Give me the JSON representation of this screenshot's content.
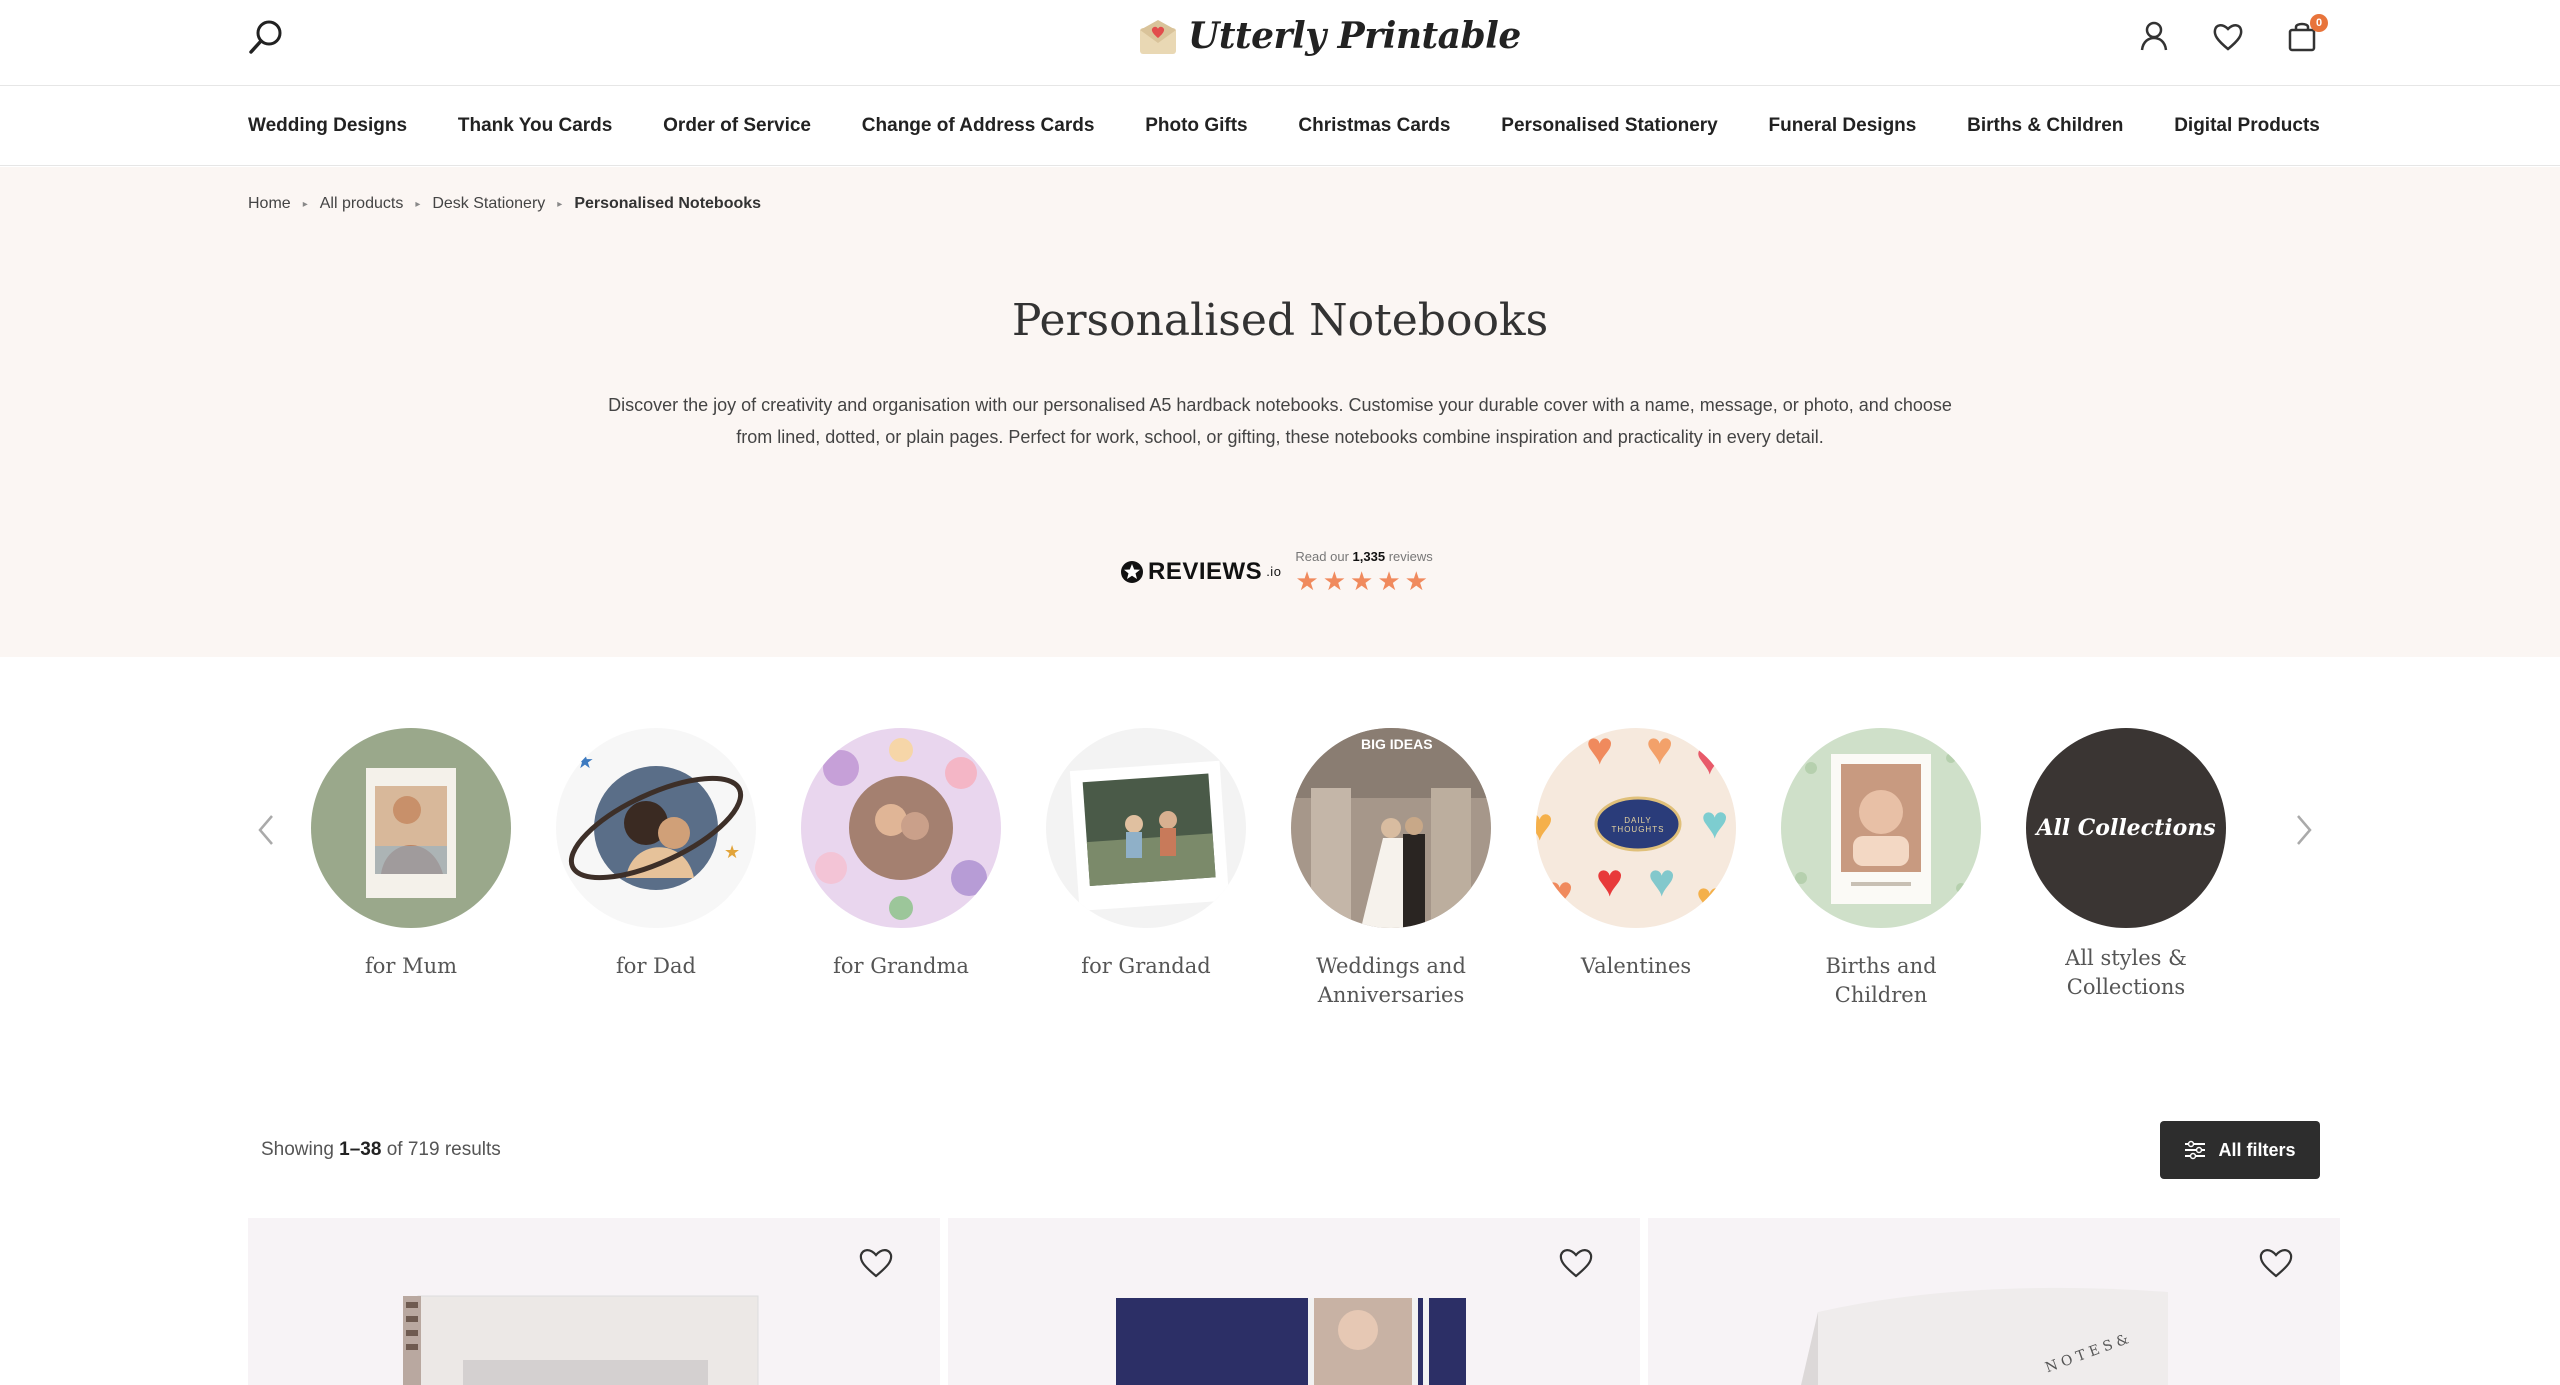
{
  "header": {
    "brand": "Utterly Printable",
    "cart_count": "0",
    "icons": [
      "search-icon",
      "account-icon",
      "wishlist-heart-icon",
      "cart-bag-icon"
    ]
  },
  "nav": {
    "items": [
      "Wedding Designs",
      "Thank You Cards",
      "Order of Service",
      "Change of Address Cards",
      "Photo Gifts",
      "Christmas Cards",
      "Personalised Stationery",
      "Funeral Designs",
      "Births & Children",
      "Digital Products"
    ]
  },
  "breadcrumb": [
    "Home",
    "All products",
    "Desk Stationery",
    "Personalised Notebooks"
  ],
  "hero": {
    "title": "Personalised Notebooks",
    "description": "Discover the joy of creativity and organisation with our personalised A5 hardback notebooks. Customise your durable cover with a name, message, or photo, and choose from lined, dotted, or plain pages. Perfect for work, school, or gifting, these notebooks combine inspiration and practicality in every detail."
  },
  "reviews": {
    "logo": "REVIEWS",
    "logo_suffix": ".io",
    "read_prefix": "Read our",
    "count": "1,335",
    "read_suffix": "reviews",
    "rating": 5,
    "star_color": "#f08a5d"
  },
  "collections": [
    {
      "label": "for Mum"
    },
    {
      "label": "for Dad"
    },
    {
      "label": "for Grandma"
    },
    {
      "label": "for Grandad"
    },
    {
      "label": "Weddings and Anniversaries",
      "badge": "BIG IDEAS"
    },
    {
      "label": "Valentines",
      "badge": "DAILY THOUGHTS"
    },
    {
      "label": "Births and Children"
    },
    {
      "label": "All styles & Collections",
      "circle_text": "All Collections"
    }
  ],
  "results": {
    "prefix": "Showing",
    "range": "1–38",
    "middle": "of 719 results",
    "filters_label": "All filters"
  },
  "colors": {
    "accent": "#e8743b",
    "hero_bg": "#fbf6f3",
    "dark_button": "#2d2d2d"
  }
}
